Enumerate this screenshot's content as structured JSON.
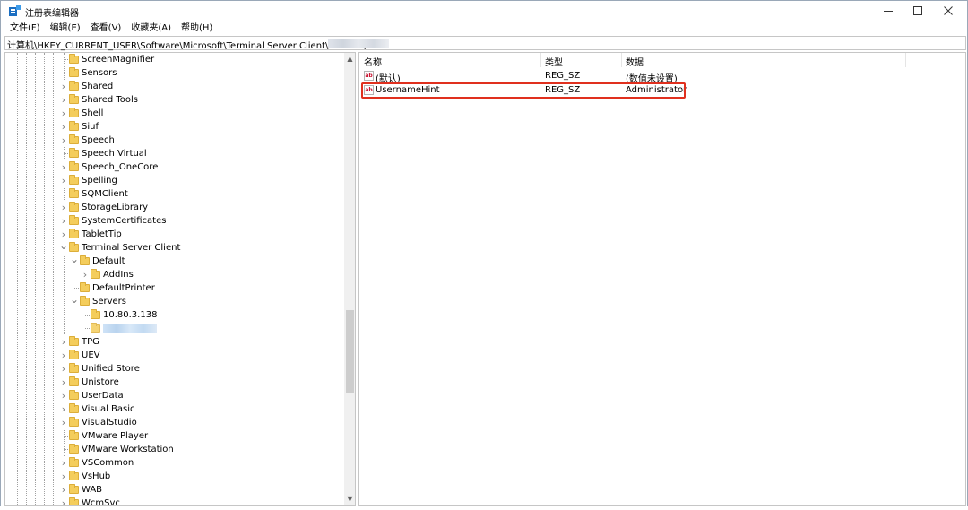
{
  "window": {
    "title": "注册表编辑器"
  },
  "menu": [
    "文件(F)",
    "编辑(E)",
    "查看(V)",
    "收藏夹(A)",
    "帮助(H)"
  ],
  "address": {
    "path": "计算机\\HKEY_CURRENT_USER\\Software\\Microsoft\\Terminal Server Client\\Servers\\"
  },
  "tree": [
    {
      "label": "ScreenMagnifier",
      "level": 0,
      "expander": "none"
    },
    {
      "label": "Sensors",
      "level": 0,
      "expander": "none"
    },
    {
      "label": "Shared",
      "level": 0,
      "expander": "collapsed"
    },
    {
      "label": "Shared Tools",
      "level": 0,
      "expander": "collapsed"
    },
    {
      "label": "Shell",
      "level": 0,
      "expander": "collapsed"
    },
    {
      "label": "Siuf",
      "level": 0,
      "expander": "collapsed"
    },
    {
      "label": "Speech",
      "level": 0,
      "expander": "collapsed"
    },
    {
      "label": "Speech Virtual",
      "level": 0,
      "expander": "none"
    },
    {
      "label": "Speech_OneCore",
      "level": 0,
      "expander": "collapsed"
    },
    {
      "label": "Spelling",
      "level": 0,
      "expander": "collapsed"
    },
    {
      "label": "SQMClient",
      "level": 0,
      "expander": "none"
    },
    {
      "label": "StorageLibrary",
      "level": 0,
      "expander": "collapsed"
    },
    {
      "label": "SystemCertificates",
      "level": 0,
      "expander": "collapsed"
    },
    {
      "label": "TabletTip",
      "level": 0,
      "expander": "collapsed"
    },
    {
      "label": "Terminal Server Client",
      "level": 0,
      "expander": "expanded"
    },
    {
      "label": "Default",
      "level": 1,
      "expander": "expanded"
    },
    {
      "label": "AddIns",
      "level": 2,
      "expander": "collapsed"
    },
    {
      "label": "DefaultPrinter",
      "level": 1,
      "expander": "none"
    },
    {
      "label": "Servers",
      "level": 1,
      "expander": "expanded"
    },
    {
      "label": "10.80.3.138",
      "level": 2,
      "expander": "none"
    },
    {
      "label": "",
      "level": 2,
      "expander": "none",
      "redacted": true
    },
    {
      "label": "TPG",
      "level": 0,
      "expander": "collapsed"
    },
    {
      "label": "UEV",
      "level": 0,
      "expander": "collapsed"
    },
    {
      "label": "Unified Store",
      "level": 0,
      "expander": "collapsed"
    },
    {
      "label": "Unistore",
      "level": 0,
      "expander": "collapsed"
    },
    {
      "label": "UserData",
      "level": 0,
      "expander": "collapsed"
    },
    {
      "label": "Visual Basic",
      "level": 0,
      "expander": "collapsed"
    },
    {
      "label": "VisualStudio",
      "level": 0,
      "expander": "collapsed"
    },
    {
      "label": "VMware Player",
      "level": 0,
      "expander": "none"
    },
    {
      "label": "VMware Workstation",
      "level": 0,
      "expander": "none"
    },
    {
      "label": "VSCommon",
      "level": 0,
      "expander": "collapsed"
    },
    {
      "label": "VsHub",
      "level": 0,
      "expander": "collapsed"
    },
    {
      "label": "WAB",
      "level": 0,
      "expander": "collapsed"
    },
    {
      "label": "WcmSvc",
      "level": 0,
      "expander": "collapsed"
    }
  ],
  "list": {
    "columns": [
      "名称",
      "类型",
      "数据"
    ],
    "rows": [
      {
        "name": "(默认)",
        "type": "REG_SZ",
        "data": "(数值未设置)",
        "icon": "ab"
      },
      {
        "name": "UsernameHint",
        "type": "REG_SZ",
        "data": "Administrator",
        "icon": "ab"
      }
    ]
  },
  "colors": {
    "highlight": "#e0301e",
    "folder": "#f4cd5c",
    "selection": "#cce8ff"
  }
}
